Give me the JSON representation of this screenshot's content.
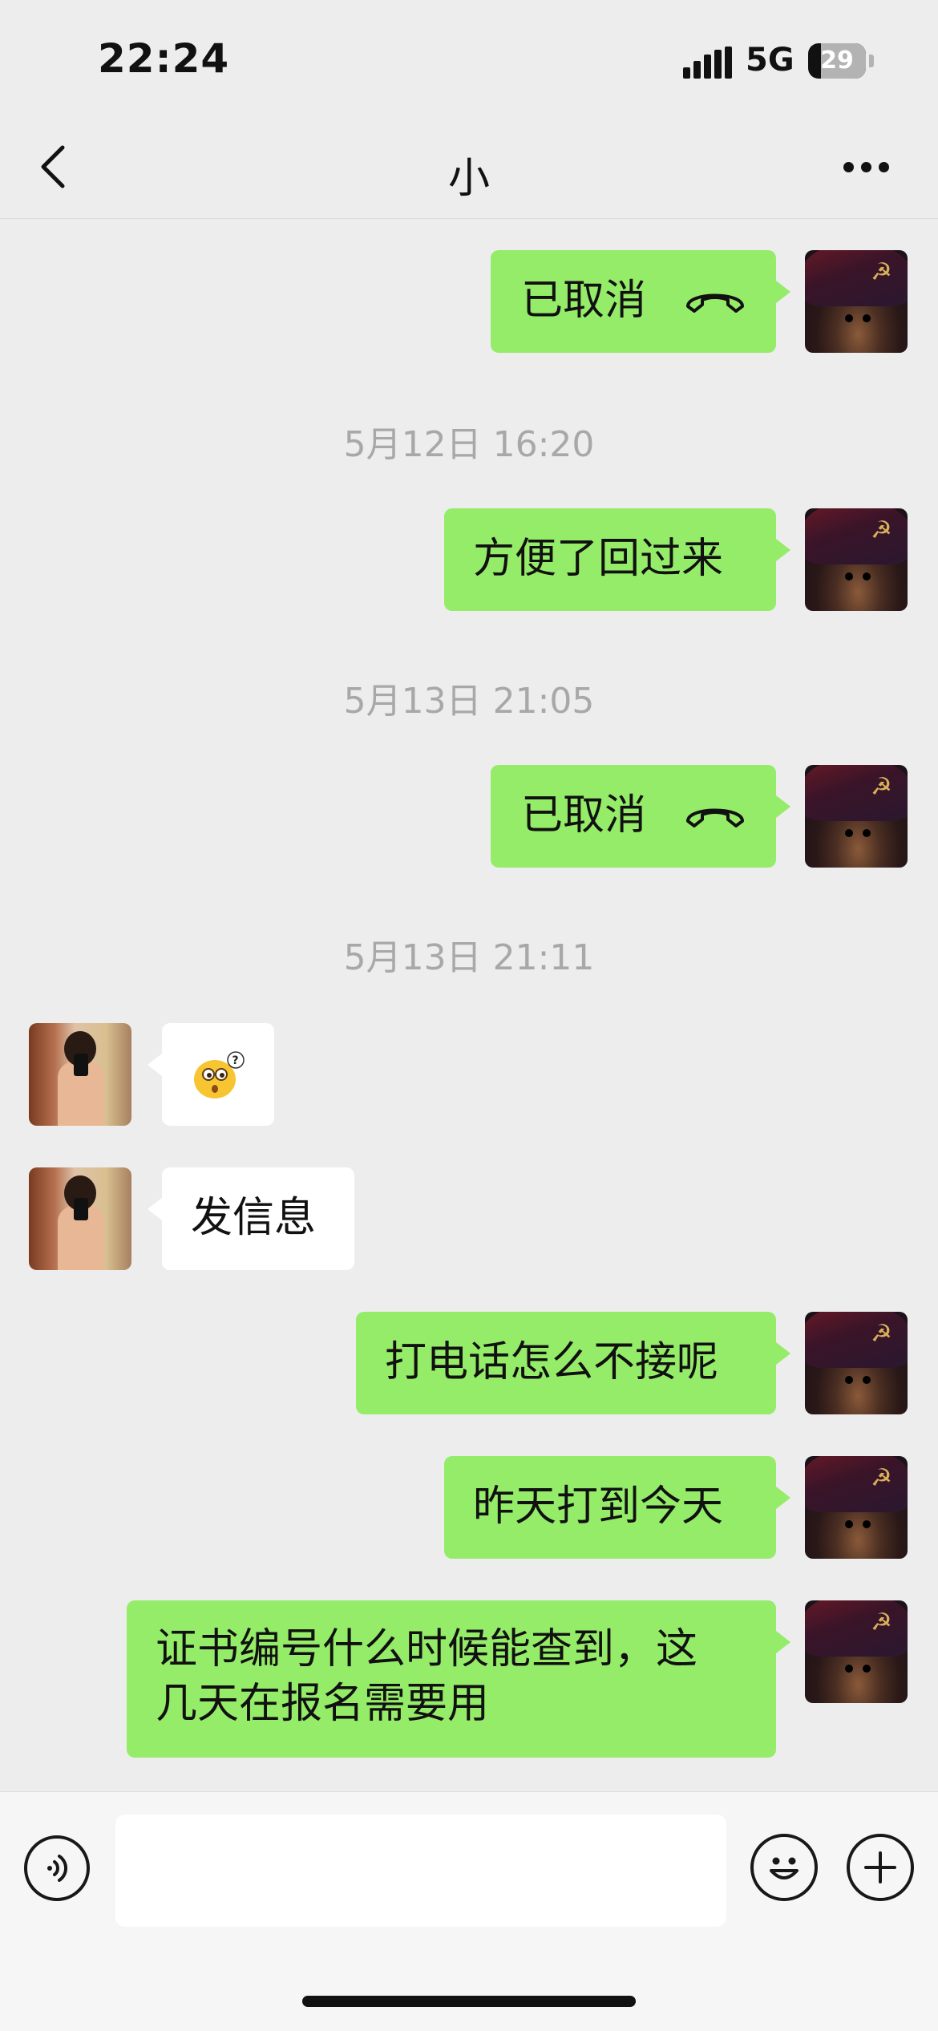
{
  "status_bar": {
    "time": "22:24",
    "network": "5G",
    "battery": "29"
  },
  "nav": {
    "title": "小"
  },
  "messages": {
    "m1_text": "已取消",
    "ts1": "5月12日 16:20",
    "m2_text": "方便了回过来",
    "ts2": "5月13日 21:05",
    "m3_text": "已取消",
    "ts3": "5月13日 21:11",
    "m4_emoji": "confused-face-emoji",
    "m5_text": "发信息",
    "m6_text": "打电话怎么不接呢",
    "m7_text": "昨天打到今天",
    "m8_line1": "证书编号什么时候能查到，这",
    "m8_line2": "几天在报名需要用"
  },
  "input": {
    "value": "",
    "placeholder": ""
  },
  "colors": {
    "my_bubble": "#95ec69",
    "other_bubble": "#ffffff",
    "background": "#ededed",
    "timestamp": "#a8a8a8"
  },
  "icons": [
    "back-icon",
    "more-icon",
    "hang-up-icon",
    "voice-icon",
    "emoji-icon",
    "plus-icon"
  ]
}
